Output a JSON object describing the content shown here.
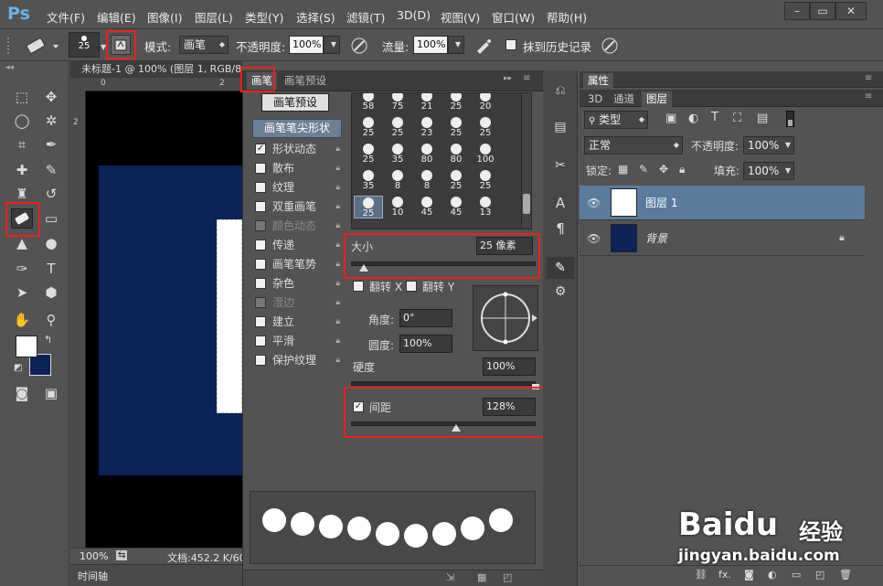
{
  "app": {
    "logo": "Ps"
  },
  "menu": [
    {
      "label": "文件(F)"
    },
    {
      "label": "编辑(E)"
    },
    {
      "label": "图像(I)"
    },
    {
      "label": "图层(L)"
    },
    {
      "label": "类型(Y)"
    },
    {
      "label": "选择(S)"
    },
    {
      "label": "滤镜(T)"
    },
    {
      "label": "3D(D)"
    },
    {
      "label": "视图(V)"
    },
    {
      "label": "窗口(W)"
    },
    {
      "label": "帮助(H)"
    }
  ],
  "window_controls": {
    "minimize": "–",
    "restore": "▭",
    "close": "✕"
  },
  "options": {
    "brush_size": "25",
    "mode_label": "模式:",
    "mode_value": "画笔",
    "opacity_label": "不透明度:",
    "opacity_value": "100%",
    "flow_label": "流量:",
    "flow_value": "100%",
    "erase_history_label": "抹到历史记录"
  },
  "document": {
    "tab_title": "未标题-1 @ 100% (图层 1, RGB/8)",
    "ruler_marks": [
      "0",
      "2"
    ],
    "zoom": "100%",
    "doc_info": "文档:452.2 K/60",
    "timeline_label": "时间轴"
  },
  "brush_panel": {
    "tab_brush": "画笔",
    "tab_presets": "画笔预设",
    "presets_button": "画笔预设",
    "tip_shape_header": "画笔笔尖形状",
    "options": [
      {
        "label": "形状动态",
        "checked": true,
        "enabled": true
      },
      {
        "label": "散布",
        "checked": false,
        "enabled": true
      },
      {
        "label": "纹理",
        "checked": false,
        "enabled": true
      },
      {
        "label": "双重画笔",
        "checked": false,
        "enabled": true
      },
      {
        "label": "颜色动态",
        "checked": false,
        "enabled": false
      },
      {
        "label": "传递",
        "checked": false,
        "enabled": true
      },
      {
        "label": "画笔笔势",
        "checked": false,
        "enabled": true
      },
      {
        "label": "杂色",
        "checked": false,
        "enabled": true
      },
      {
        "label": "湿边",
        "checked": false,
        "enabled": false
      },
      {
        "label": "建立",
        "checked": false,
        "enabled": true
      },
      {
        "label": "平滑",
        "checked": false,
        "enabled": true
      },
      {
        "label": "保护纹理",
        "checked": false,
        "enabled": true
      }
    ],
    "tips": [
      [
        "58",
        "75",
        "21",
        "25",
        "20"
      ],
      [
        "25",
        "25",
        "23",
        "25",
        "25"
      ],
      [
        "25",
        "35",
        "80",
        "80",
        "100"
      ],
      [
        "35",
        "8",
        "8",
        "25",
        "25"
      ],
      [
        "25",
        "10",
        "45",
        "45",
        "13"
      ]
    ],
    "size_label": "大小",
    "size_value": "25 像素",
    "size_fraction": 0.07,
    "flip_x_label": "翻转 X",
    "flip_y_label": "翻转 Y",
    "angle_label": "角度:",
    "angle_value": "0°",
    "roundness_label": "圆度:",
    "roundness_value": "100%",
    "hardness_label": "硬度",
    "hardness_value": "100%",
    "spacing_label": "间距",
    "spacing_value": "128%",
    "spacing_checked": true,
    "spacing_fraction": 0.57,
    "preview_dots": 9
  },
  "right_panel": {
    "tab_properties": "属性",
    "tab_3d": "3D",
    "tab_channels": "通道",
    "tab_layers": "图层",
    "filter_kind": "类型",
    "blend_mode": "正常",
    "opacity_label": "不透明度:",
    "opacity_value": "100%",
    "lock_label": "锁定:",
    "fill_label": "填充:",
    "fill_value": "100%",
    "layers": [
      {
        "name": "图层 1",
        "thumb_color": "#ffffff",
        "selected": true,
        "locked": false
      },
      {
        "name": "背景",
        "thumb_color": "#0f2456",
        "selected": false,
        "locked": true
      }
    ],
    "footer_fx": "fx."
  },
  "watermark": {
    "brand": "Baidu",
    "brand_cn": "经验",
    "url": "jingyan.baidu.com"
  },
  "colors": {
    "accent": "#e8231b",
    "canvas_blue": "#0c2455",
    "selected_layer": "#5b7b9c"
  }
}
